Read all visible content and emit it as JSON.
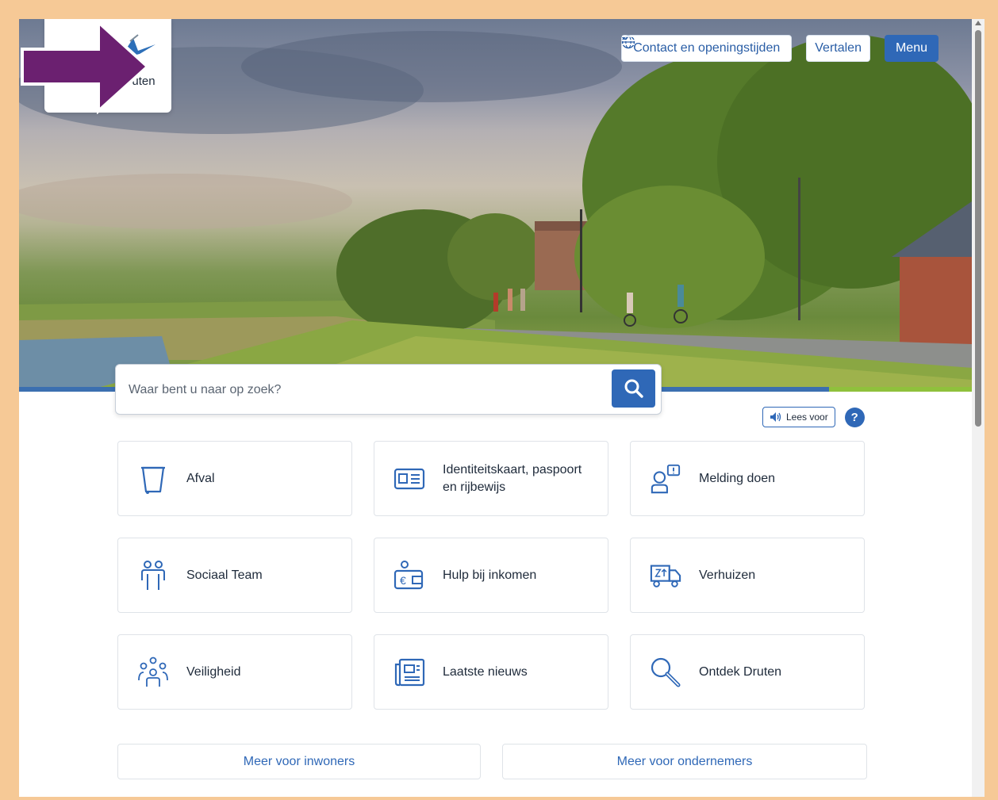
{
  "header": {
    "logo_text": "Gemeente Druten",
    "contact_label": "Contact en openingstijden",
    "translate_label": "Vertalen",
    "menu_label": "Menu"
  },
  "search": {
    "placeholder": "Waar bent u naar op zoek?"
  },
  "accessibility": {
    "read_aloud_label": "Lees voor",
    "help_label": "?"
  },
  "tiles": [
    {
      "label": "Afval",
      "icon": "trash-bin-icon"
    },
    {
      "label": "Identiteitskaart, paspoort en rijbewijs",
      "icon": "id-card-icon"
    },
    {
      "label": "Melding doen",
      "icon": "report-person-icon"
    },
    {
      "label": "Sociaal Team",
      "icon": "people-icon"
    },
    {
      "label": "Hulp bij inkomen",
      "icon": "wallet-euro-icon"
    },
    {
      "label": "Verhuizen",
      "icon": "moving-truck-icon"
    },
    {
      "label": "Veiligheid",
      "icon": "community-icon"
    },
    {
      "label": "Laatste nieuws",
      "icon": "newspaper-icon"
    },
    {
      "label": "Ontdek Druten",
      "icon": "magnifier-icon"
    }
  ],
  "more": {
    "residents": "Meer voor inwoners",
    "business": "Meer voor ondernemers"
  },
  "colors": {
    "primary": "#2f68b7",
    "accent_green": "#8fc13c",
    "frame": "#f6c996",
    "annotation_arrow": "#6b2070"
  }
}
